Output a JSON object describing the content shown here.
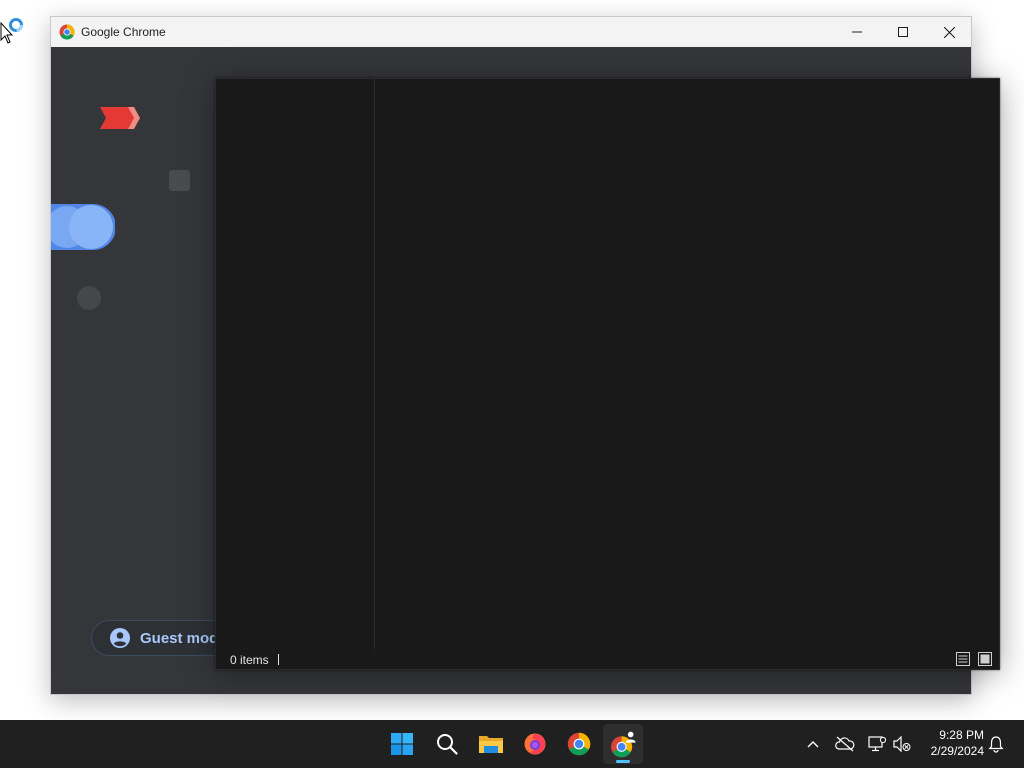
{
  "window": {
    "title": "Google Chrome",
    "buttons": [
      "minimize",
      "maximize",
      "close"
    ]
  },
  "page": {
    "guest_label": "Guest mod"
  },
  "dialog": {
    "item_count": "0 items"
  },
  "taskbar": {
    "apps": [
      "start-icon",
      "search-icon",
      "file-explorer-icon",
      "firefox-icon",
      "chrome-icon",
      "chrome-guest-icon"
    ],
    "clock_time": "9:28 PM",
    "clock_date": "2/29/2024"
  },
  "colors": {
    "accent": "#4cc2ff",
    "guest_text": "#a8c7fa",
    "window_bg": "#35363a",
    "dialog_bg": "#191919"
  }
}
